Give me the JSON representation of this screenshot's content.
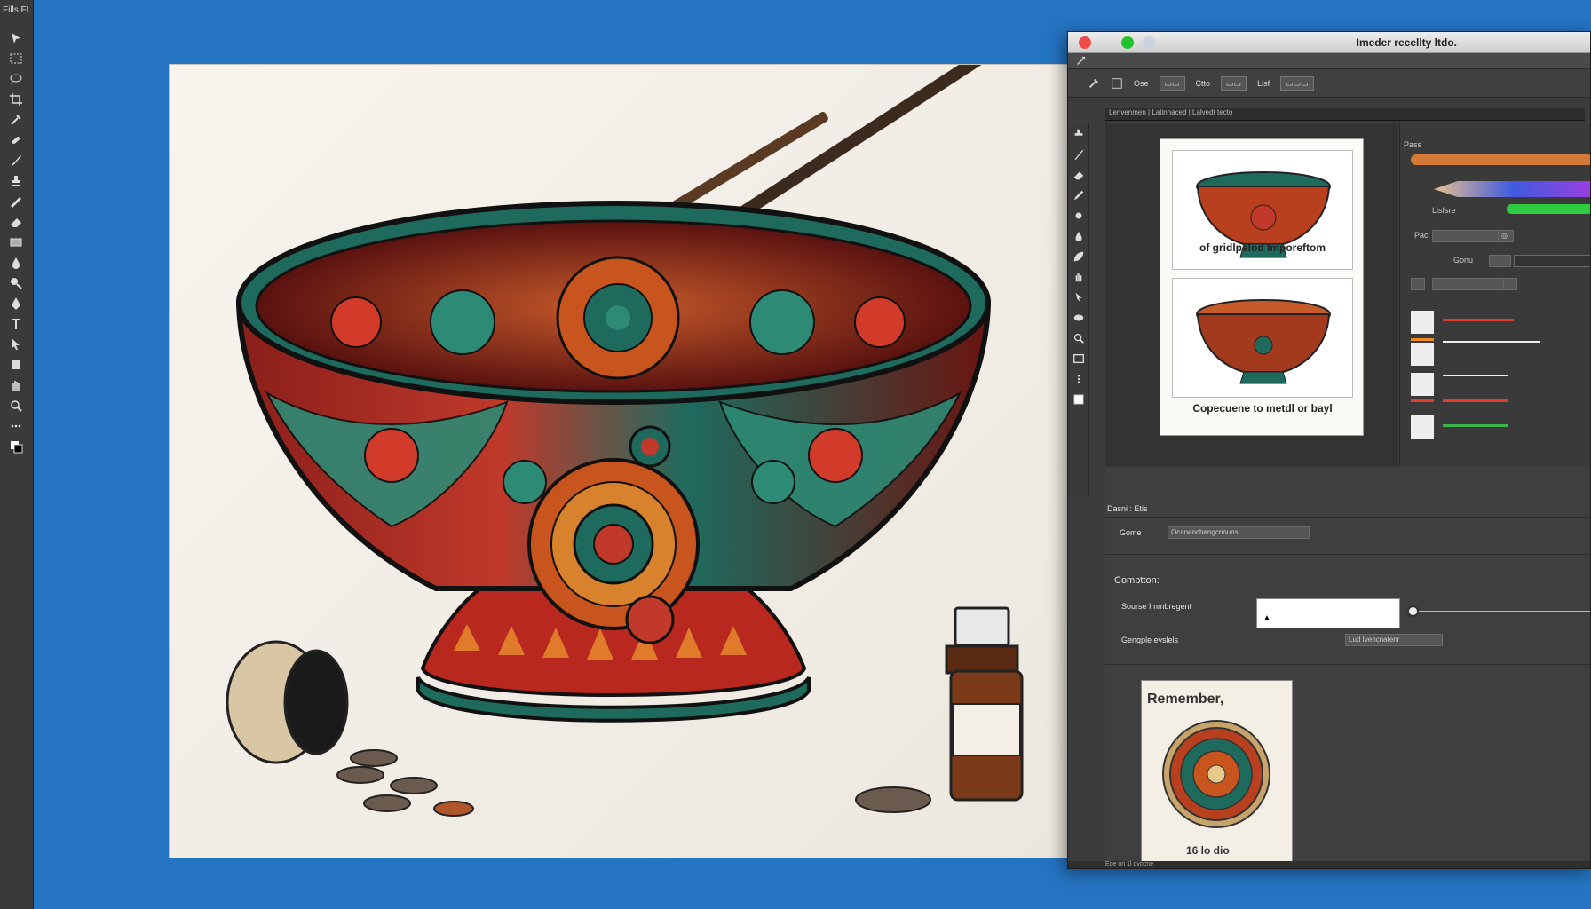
{
  "left_toolbar": {
    "header": "Fills FL"
  },
  "window": {
    "title": "Imeder recellty ltdo.",
    "traffic_lights": {
      "close": "#ef4d4a",
      "minimize": "#22c42e",
      "zoom": "#c9d3de"
    }
  },
  "options_bar": {
    "items": [
      "Ose",
      "Ctto",
      "Lisf"
    ]
  },
  "tab_row": {
    "label": "Lenvenmen | Latinnaced | Lalvedt tecto"
  },
  "preview": {
    "caption_top": "of gridlpelod Imporeftom",
    "caption_bottom": "Copecuene to metdl or bayl"
  },
  "right_panel": {
    "label_top": "Pass",
    "label_brush": "Lisfsre",
    "label_row1": "Pac",
    "label_row2": "Gonu",
    "colors": {
      "brush_blue": "#3f5ae0",
      "brush_green": "#2ecc40",
      "slider_red": "#e23b30",
      "slider_orange": "#ef8a20",
      "slider_green": "#39b54a"
    }
  },
  "bottom": {
    "row_header": "Dasni : Etis",
    "row_label": "Gome",
    "row_field": "Ocanenchengcnouns",
    "section_title": "Comptton:",
    "option1_label": "Sourse Immbregent",
    "option2_label": "Gengple eyslels",
    "option2_field": "Lud Ivencnatenr",
    "notice_title": "Remember,",
    "notice_footer": "16 lo dio"
  },
  "status_bar": {
    "text": "Eoe on 1l ovocne"
  }
}
